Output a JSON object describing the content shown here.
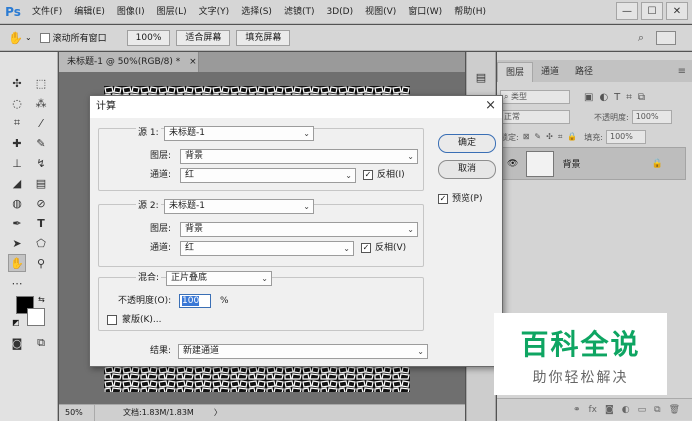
{
  "menubar": {
    "logo": "Ps",
    "items": [
      "文件(F)",
      "编辑(E)",
      "图像(I)",
      "图层(L)",
      "文字(Y)",
      "选择(S)",
      "滤镜(T)",
      "3D(D)",
      "视图(V)",
      "窗口(W)",
      "帮助(H)"
    ],
    "window_buttons": [
      "—",
      "☐",
      "✕"
    ]
  },
  "optionsbar": {
    "scroll_all": "滚动所有窗口",
    "zoom_value": "100%",
    "fit_screen": "适合屏幕",
    "fill_screen": "填充屏幕"
  },
  "document": {
    "tab_title": "未标题-1 @ 50%(RGB/8) *",
    "tab_close": "×",
    "zoom": "50%",
    "doc_info": "文档:1.83M/1.83M",
    "arrow": "〉"
  },
  "layers_panel": {
    "tabs": [
      "图层",
      "通道",
      "路径"
    ],
    "filter_kind": "类型",
    "blend_mode": "正常",
    "opacity_label": "不透明度:",
    "opacity_value": "100%",
    "lock_label": "锁定:",
    "fill_label": "填充:",
    "fill_value": "100%",
    "layer_name": "背景"
  },
  "dialog": {
    "title": "计算",
    "close": "×",
    "source1": {
      "label": "源 1:",
      "value": "未标题-1",
      "layer_label": "图层:",
      "layer_value": "背景",
      "channel_label": "通道:",
      "channel_value": "红",
      "invert_label": "反相(I)",
      "invert_checked": true
    },
    "source2": {
      "label": "源 2:",
      "value": "未标题-1",
      "layer_label": "图层:",
      "layer_value": "背景",
      "channel_label": "通道:",
      "channel_value": "红",
      "invert_label": "反相(V)",
      "invert_checked": true
    },
    "blending": {
      "label": "混合:",
      "value": "正片叠底",
      "opacity_label": "不透明度(O):",
      "opacity_value": "100",
      "opacity_unit": "%",
      "mask_label": "蒙版(K)...",
      "mask_checked": false
    },
    "result_label": "结果:",
    "result_value": "新建通道",
    "ok_button": "确定",
    "cancel_button": "取消",
    "preview_label": "预览(P)",
    "preview_checked": true
  },
  "watermark": {
    "title": "百科全说",
    "subtitle": "助你轻松解决"
  },
  "colors": {
    "accent": "#2a7bd3",
    "watermark_green": "#0ea562",
    "dialog_bg": "#f0f0f0"
  }
}
